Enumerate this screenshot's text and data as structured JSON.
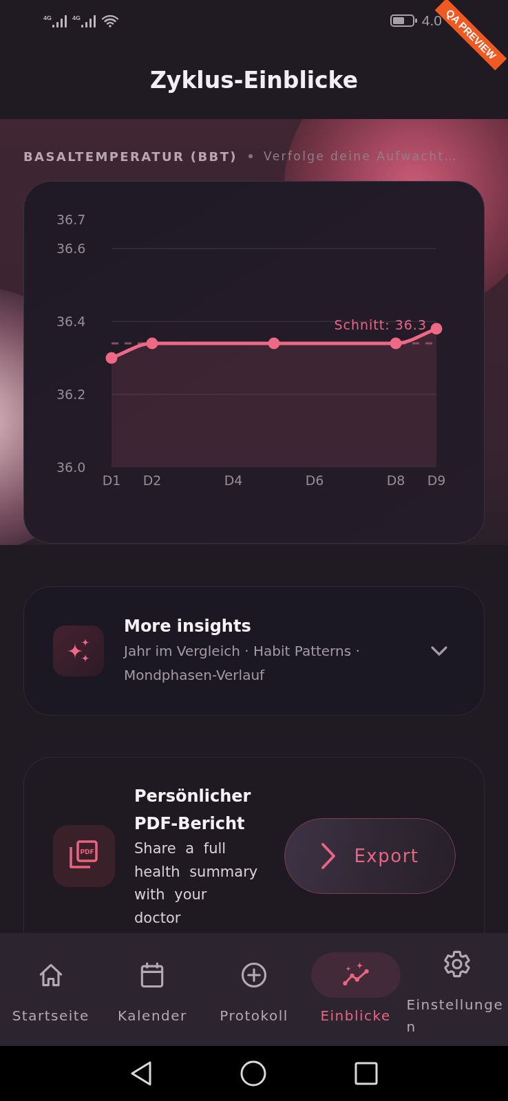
{
  "status_bar": {
    "networks": [
      {
        "label": "4G"
      },
      {
        "label": "4G"
      }
    ],
    "time": "4.0"
  },
  "debug_banner": {
    "label": "QA PREVIEW"
  },
  "header": {
    "title": "Zyklus-Einblicke"
  },
  "bbt_section": {
    "title": "BASALTEMPERATUR (BBT)",
    "subtitle": "Verfolge deine Aufwacht…",
    "chart_data": {
      "type": "area",
      "categories": [
        "D1",
        "D2",
        null,
        "D4",
        null,
        "D6",
        null,
        "D8",
        "D9"
      ],
      "series": [
        {
          "color": "#ee6985",
          "values": [
            36.3,
            36.34,
            null,
            null,
            36.34,
            null,
            null,
            36.34,
            36.38
          ]
        }
      ],
      "ylim": [
        36.0,
        36.68
      ],
      "yticks": [
        {
          "value": 36.0,
          "label": "36.0"
        },
        {
          "value": 36.2,
          "label": "36.2"
        },
        {
          "value": 36.4,
          "label": "36.4"
        },
        {
          "value": 36.6,
          "label": "36.6"
        },
        {
          "value": 36.68,
          "label": "36.7"
        }
      ],
      "grid": true,
      "ref_lines": [
        {
          "axis": "y",
          "value": 36.34,
          "label": "Schnitt: 36.3"
        }
      ]
    }
  },
  "more_insights": {
    "title": "More insights",
    "subtitle": "Jahr im Vergleich · Habit Patterns · Mondphasen-Verlauf",
    "expanded": false
  },
  "pdf_report": {
    "icon_label": "PDF",
    "title": "Persönlicher PDF-Bericht",
    "description": "Share a full health summary with your doctor",
    "button": "Export"
  },
  "bottom_nav": {
    "items": [
      {
        "label": "Startseite",
        "selected": false
      },
      {
        "label": "Kalender",
        "selected": false
      },
      {
        "label": "Protokoll",
        "selected": false
      },
      {
        "label": "Einblicke",
        "selected": true
      },
      {
        "label": "Einstellungen",
        "selected": false
      }
    ]
  }
}
